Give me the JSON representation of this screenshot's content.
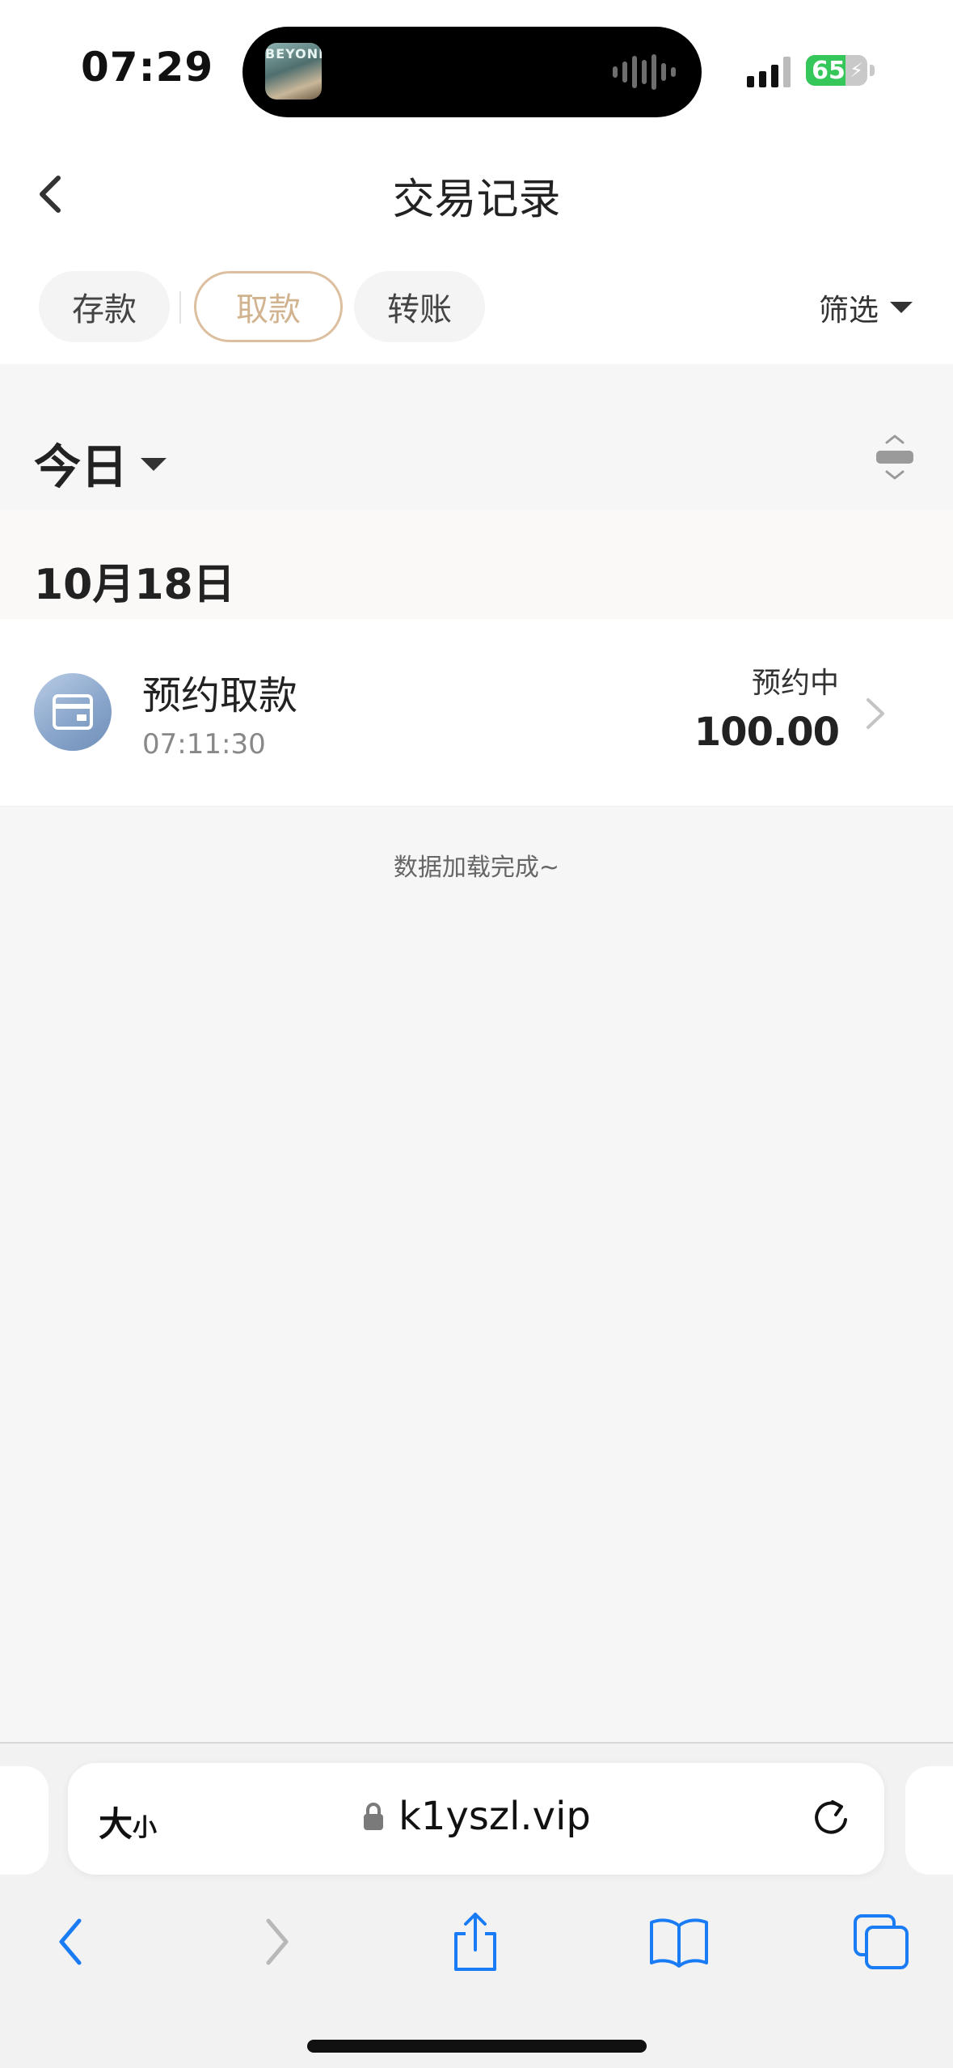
{
  "status_bar": {
    "time": "07:29",
    "battery_percent": 65,
    "battery_label": "65",
    "island_art_text": "BEYOND"
  },
  "header": {
    "title": "交易记录"
  },
  "tabs": [
    {
      "label": "存款",
      "active": false
    },
    {
      "label": "取款",
      "active": true
    },
    {
      "label": "转账",
      "active": false
    }
  ],
  "filter": {
    "label": "筛选"
  },
  "period": {
    "label": "今日"
  },
  "groups": [
    {
      "date": "10月18日",
      "transactions": [
        {
          "title": "预约取款",
          "time": "07:11:30",
          "status": "预约中",
          "amount": "100.00",
          "icon": "card-icon"
        }
      ]
    }
  ],
  "list_footer": "数据加载完成~",
  "browser": {
    "text_size_label": "大",
    "text_size_small": "小",
    "url": "k1yszl.vip"
  },
  "colors": {
    "accent": "#d2b38f",
    "accent_border": "#dcbf9f",
    "ios_blue": "#1a7cf5",
    "battery_green": "#35c759"
  }
}
